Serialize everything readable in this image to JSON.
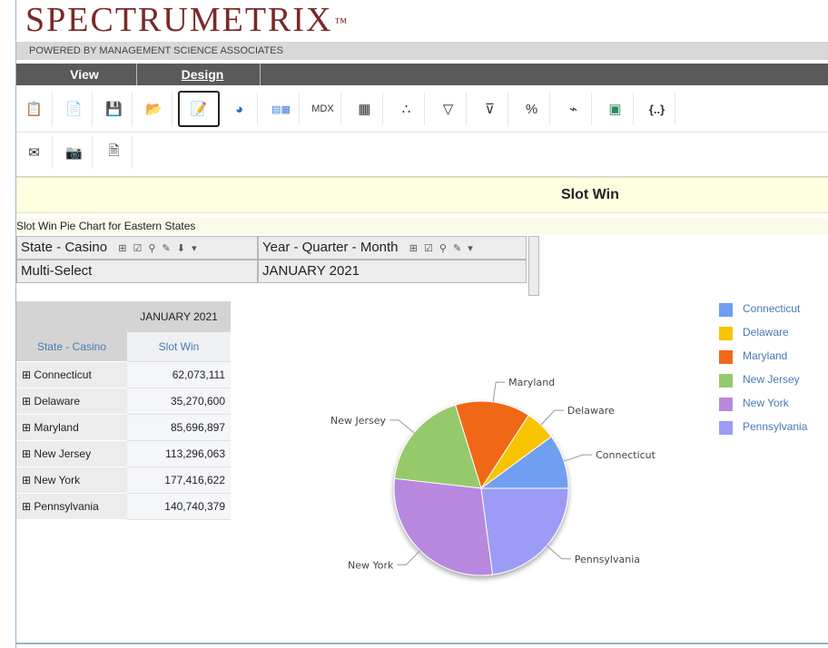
{
  "app": {
    "logo": "SPECTRUMETRIX",
    "tm": "™",
    "subtitle": "POWERED BY MANAGEMENT SCIENCE ASSOCIATES"
  },
  "menu": {
    "view": "View",
    "design": "Design"
  },
  "toolbar": {
    "mdx_label": "MDX",
    "braces_label": "{..}"
  },
  "report": {
    "title": "Slot Win",
    "caption": "Slot Win Pie Chart for Eastern States"
  },
  "filters": {
    "state_label": "State - Casino",
    "state_value": "Multi-Select",
    "period_label": "Year - Quarter - Month",
    "period_value": "JANUARY 2021"
  },
  "grid": {
    "period_header": "JANUARY 2021",
    "row_header": "State - Casino",
    "measure_header": "Slot Win",
    "rows": [
      {
        "name": "Connecticut",
        "value": "62,073,111"
      },
      {
        "name": "Delaware",
        "value": "35,270,600"
      },
      {
        "name": "Maryland",
        "value": "85,696,897"
      },
      {
        "name": "New Jersey",
        "value": "113,296,063"
      },
      {
        "name": "New York",
        "value": "177,416,622"
      },
      {
        "name": "Pennsylvania",
        "value": "140,740,379"
      }
    ]
  },
  "chart_data": {
    "type": "pie",
    "categories": [
      "Connecticut",
      "Delaware",
      "Maryland",
      "New Jersey",
      "New York",
      "Pennsylvania"
    ],
    "values": [
      62073111,
      35270600,
      85696897,
      113296063,
      177416622,
      140740379
    ],
    "colors": [
      "#6f9ef0",
      "#f8c400",
      "#f06818",
      "#96c86c",
      "#b788de",
      "#9c9cf6"
    ],
    "legend_position": "right"
  }
}
